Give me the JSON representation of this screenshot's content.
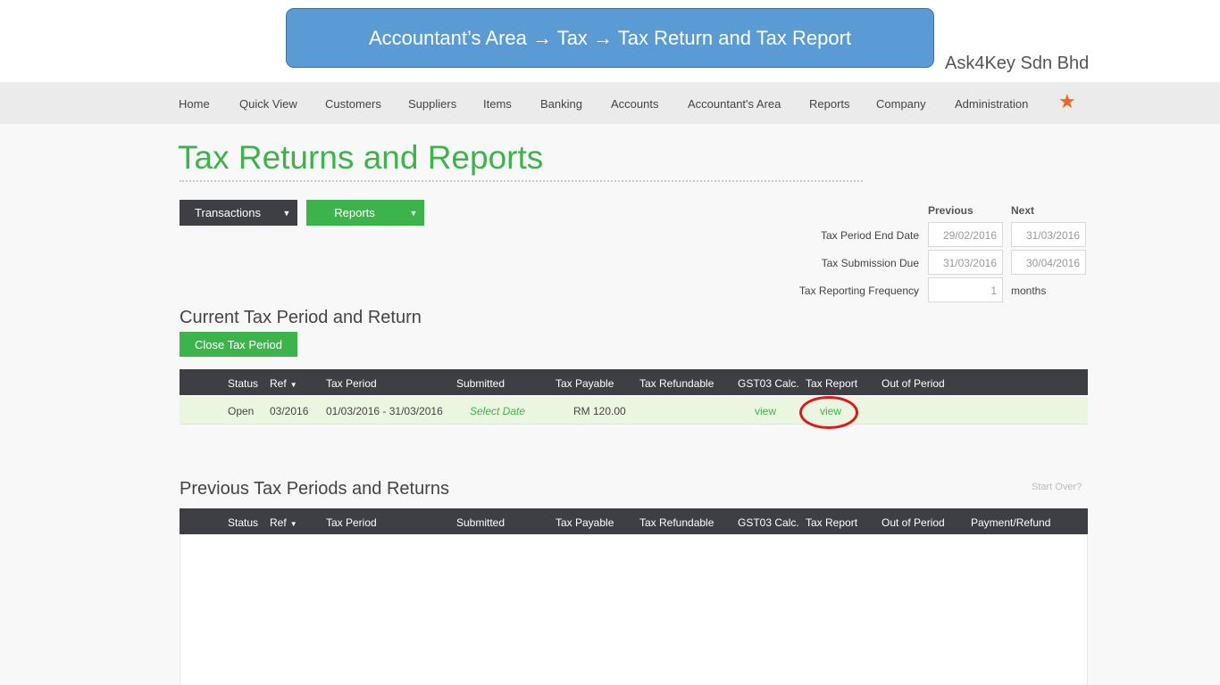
{
  "banner": {
    "text": "Accountant’s Area → Tax → Tax Return and Tax Report"
  },
  "company": {
    "name": "Ask4Key Sdn Bhd"
  },
  "nav": {
    "items": [
      "Home",
      "Quick View",
      "Customers",
      "Suppliers",
      "Items",
      "Banking",
      "Accounts",
      "Accountant's Area",
      "Reports",
      "Company",
      "Administration"
    ],
    "favorite_icon": "star-icon",
    "favorite_color": "#f26522"
  },
  "page": {
    "title": "Tax Returns and Reports"
  },
  "toolbar": {
    "transactions_label": "Transactions",
    "reports_label": "Reports"
  },
  "period_info": {
    "previous_header": "Previous",
    "next_header": "Next",
    "end_date_label": "Tax Period End Date",
    "end_date_previous": "29/02/2016",
    "end_date_next": "31/03/2016",
    "submission_due_label": "Tax Submission Due",
    "submission_due_previous": "31/03/2016",
    "submission_due_next": "30/04/2016",
    "frequency_label": "Tax Reporting Frequency",
    "frequency_value": "1",
    "frequency_unit": "months"
  },
  "current": {
    "heading": "Current Tax Period and Return",
    "close_button": "Close Tax Period",
    "columns": [
      "Status",
      "Ref",
      "Tax Period",
      "Submitted",
      "Tax Payable",
      "Tax Refundable",
      "GST03 Calc.",
      "Tax Report",
      "Out of Period"
    ],
    "row": {
      "status": "Open",
      "ref": "03/2016",
      "period": "01/03/2016 - 31/03/2016",
      "submitted": "Select Date",
      "payable": "RM 120.00",
      "refundable": "",
      "gst03": "view",
      "tax_report": "view",
      "out_of_period": ""
    }
  },
  "previous": {
    "heading": "Previous Tax Periods and Returns",
    "start_over": "Start Over?",
    "columns": [
      "Status",
      "Ref",
      "Tax Period",
      "Submitted",
      "Tax Payable",
      "Tax Refundable",
      "GST03 Calc.",
      "Tax Report",
      "Out of Period",
      "Payment/Refund"
    ]
  },
  "colors": {
    "accent_green": "#3cb44b",
    "dark_header": "#3d3f45",
    "highlight_circle": "#e0161b",
    "banner_blue": "#5b9bd5"
  }
}
